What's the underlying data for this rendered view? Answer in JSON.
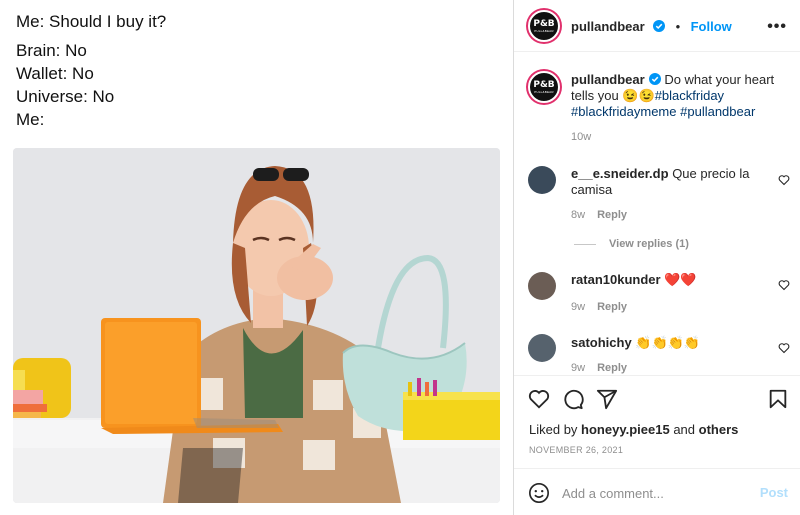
{
  "meme": {
    "lines": [
      "Me: Should I buy it?",
      "Brain: No",
      "Wallet: No",
      "Universe: No",
      "Me:"
    ]
  },
  "header": {
    "logo_text": "P&B",
    "logo_sub": "PULL&BEAR",
    "username": "pullandbear",
    "separator": "•",
    "follow_label": "Follow",
    "more_label": "•••"
  },
  "caption": {
    "username": "pullandbear",
    "text": "Do what your heart tells you 😉😉",
    "tags": [
      "#blackfriday",
      "#blackfridaymeme",
      "#pullandbear"
    ],
    "age": "10w"
  },
  "comments": [
    {
      "username": "e__e.sneider.dp",
      "text": "Que precio la camisa",
      "age": "8w",
      "reply_label": "Reply",
      "view_replies": "View replies (1)"
    },
    {
      "username": "ratan10kunder",
      "text": "❤️❤️",
      "age": "9w",
      "reply_label": "Reply"
    },
    {
      "username": "satohichy",
      "text": "👏👏👏👏",
      "age": "9w",
      "reply_label": "Reply"
    }
  ],
  "actions": {
    "liked_by_prefix": "Liked by",
    "liked_by_user": "honeyy.piee15",
    "liked_by_and": "and",
    "liked_by_others": "others",
    "date": "NOVEMBER 26, 2021"
  },
  "add_comment": {
    "placeholder": "Add a comment...",
    "post_label": "Post"
  },
  "colors": {
    "accent": "#0095f6",
    "tag": "#00376b",
    "muted": "#8e8e8e",
    "post_disabled": "#b2dffc"
  }
}
